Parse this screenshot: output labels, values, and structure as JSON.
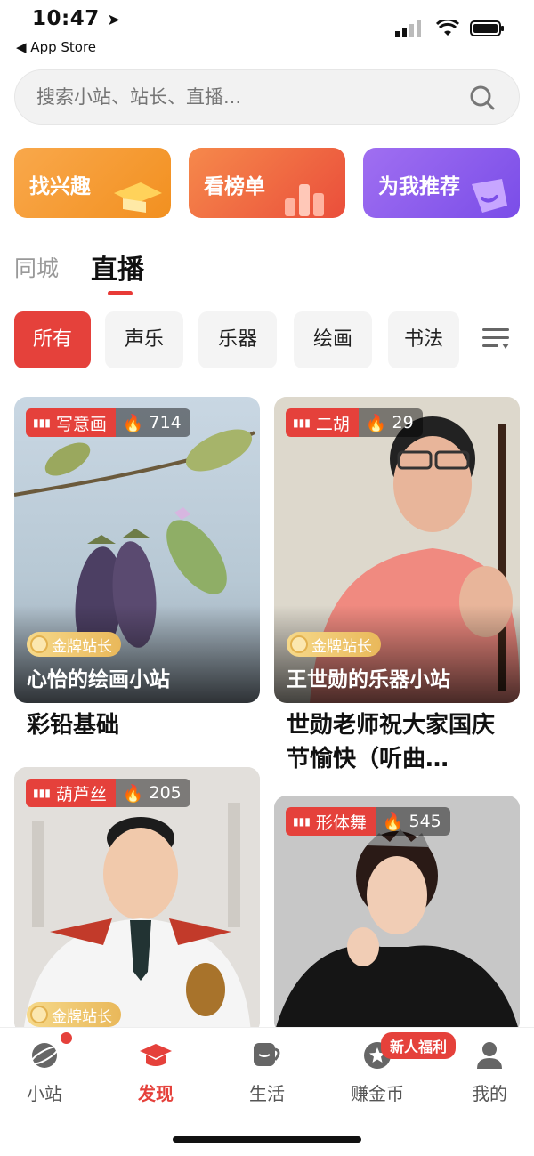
{
  "status": {
    "time": "10:47",
    "back_label": "◀ App Store"
  },
  "search": {
    "placeholder": "搜索小站、站长、直播..."
  },
  "quick_cards": [
    {
      "label": "找兴趣",
      "color_from": "#f9a84b",
      "color_to": "#f39122"
    },
    {
      "label": "看榜单",
      "color_from": "#f5894c",
      "color_to": "#ec5a3e"
    },
    {
      "label": "为我推荐",
      "color_from": "#9a6cf0",
      "color_to": "#7d50ea"
    }
  ],
  "tabs": [
    {
      "label": "同城"
    },
    {
      "label": "直播"
    }
  ],
  "chips": [
    {
      "label": "所有"
    },
    {
      "label": "声乐"
    },
    {
      "label": "乐器"
    },
    {
      "label": "绘画"
    },
    {
      "label": "书法"
    }
  ],
  "live_items": [
    {
      "category": "写意画",
      "heat": "714",
      "gold_badge": "金牌站长",
      "station": "心怡的绘画小站",
      "title": "彩铅基础"
    },
    {
      "category": "二胡",
      "heat": "29",
      "gold_badge": "金牌站长",
      "station": "王世勋的乐器小站",
      "title": "世勋老师祝大家国庆节愉快（听曲…"
    },
    {
      "category": "葫芦丝",
      "heat": "205",
      "gold_badge": "金牌站长",
      "station": "",
      "title": ""
    },
    {
      "category": "形体舞",
      "heat": "545",
      "gold_badge": "",
      "station": "",
      "title": ""
    }
  ],
  "bottom_nav": [
    {
      "label": "小站",
      "icon": "planet-icon"
    },
    {
      "label": "发现",
      "icon": "graduation-cap-icon"
    },
    {
      "label": "生活",
      "icon": "cup-icon"
    },
    {
      "label": "赚金币",
      "icon": "coin-star-icon"
    },
    {
      "label": "我的",
      "icon": "user-icon"
    }
  ],
  "promo_badge": "新人福利",
  "colors": {
    "accent": "#e5413b"
  }
}
